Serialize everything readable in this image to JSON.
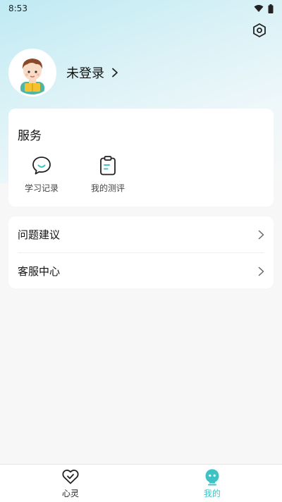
{
  "status_bar": {
    "time": "8:53",
    "icons": [
      "wifi-icon",
      "battery-icon"
    ]
  },
  "header": {
    "settings_icon": "settings-hexagon-icon"
  },
  "profile": {
    "login_label": "未登录",
    "chevron_icon": "chevron-right-icon"
  },
  "services": {
    "title": "服务",
    "items": [
      {
        "label": "学习记录",
        "icon": "chat-bubble-icon"
      },
      {
        "label": "我的测评",
        "icon": "clipboard-icon"
      }
    ]
  },
  "menu": {
    "items": [
      {
        "label": "问题建议",
        "icon": "chevron-right-icon"
      },
      {
        "label": "客服中心",
        "icon": "chevron-right-icon"
      }
    ]
  },
  "tab_bar": {
    "tabs": [
      {
        "label": "心灵",
        "icon": "heart-check-icon",
        "active": false
      },
      {
        "label": "我的",
        "icon": "smile-face-icon",
        "active": true
      }
    ],
    "active_color": "#3fc2c4",
    "inactive_color": "#222222"
  },
  "colors": {
    "accent": "#3fc2c4",
    "card_bg": "#ffffff",
    "page_bg": "#f7f7f7"
  }
}
